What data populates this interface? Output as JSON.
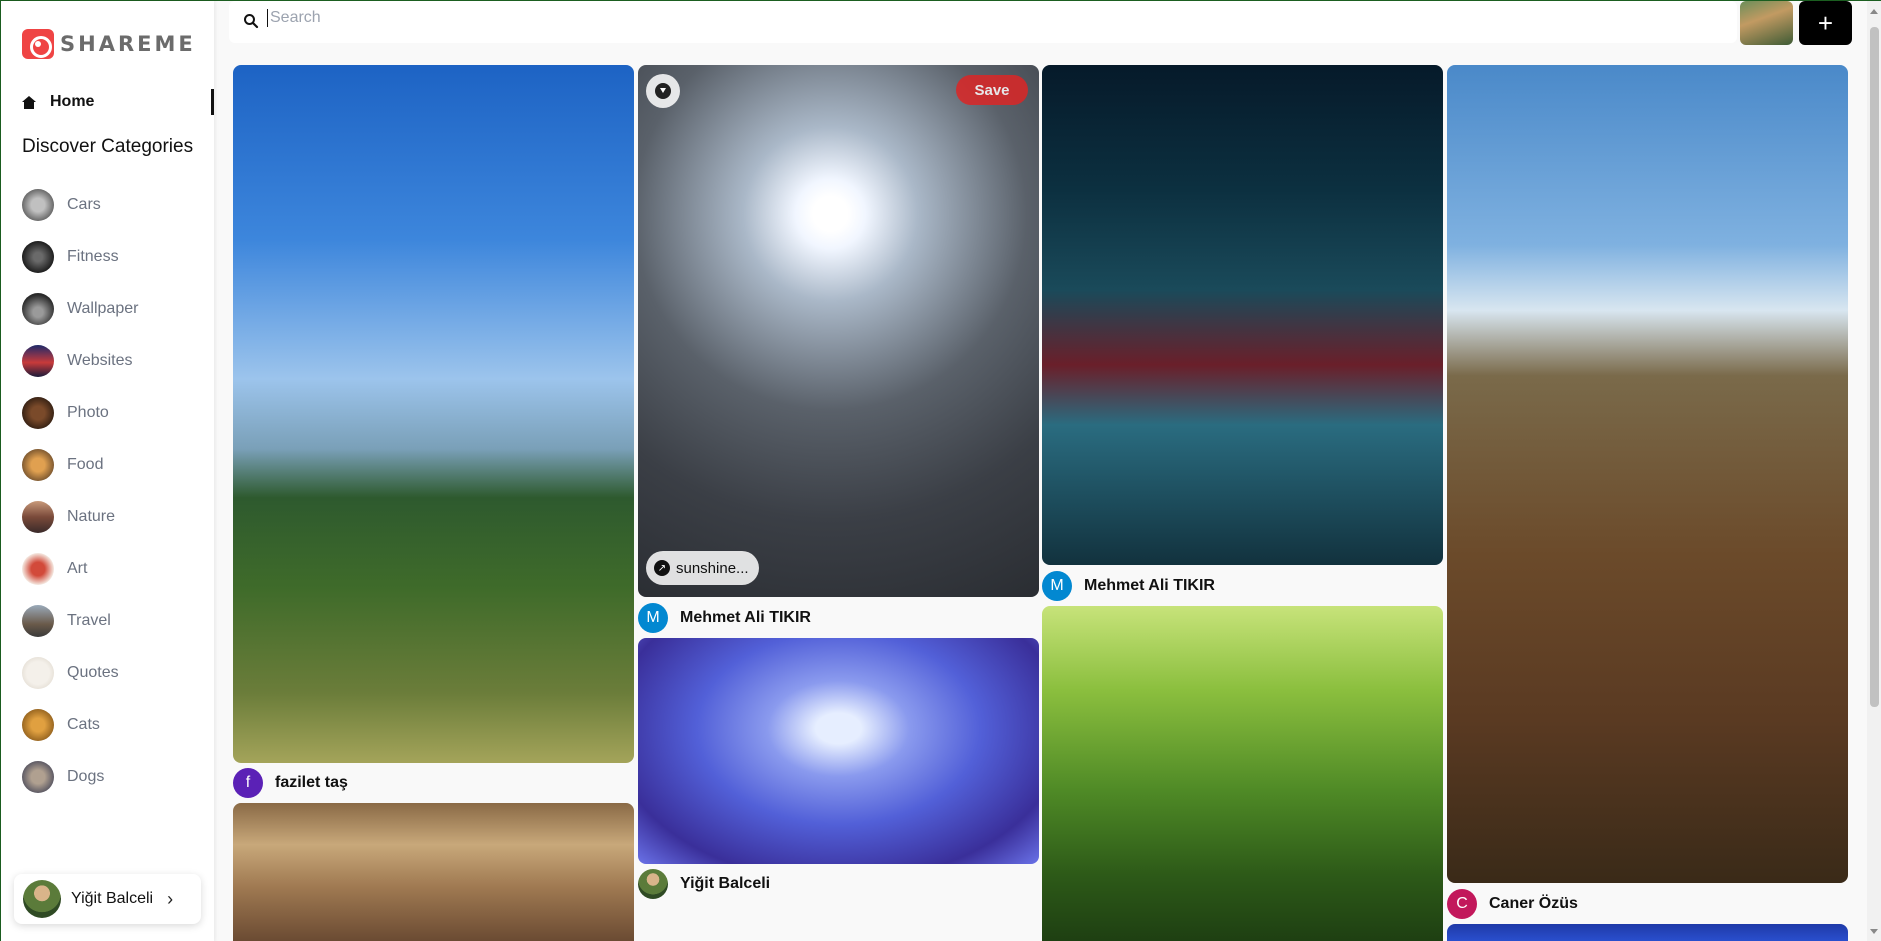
{
  "app": {
    "name": "SHAREME"
  },
  "sidebar": {
    "home_label": "Home",
    "categories_heading": "Discover Categories",
    "categories": [
      {
        "label": "Cars",
        "color": "#8a8a8a"
      },
      {
        "label": "Fitness",
        "color": "#2b2b2b"
      },
      {
        "label": "Wallpaper",
        "color": "#3a3a3a"
      },
      {
        "label": "Websites",
        "color": "#1e2a6a"
      },
      {
        "label": "Photo",
        "color": "#4a2a1a"
      },
      {
        "label": "Food",
        "color": "#b5782f"
      },
      {
        "label": "Nature",
        "color": "#8a5a3a"
      },
      {
        "label": "Art",
        "color": "#d24a3a"
      },
      {
        "label": "Travel",
        "color": "#6a7a8a"
      },
      {
        "label": "Quotes",
        "color": "#e8e2d8"
      },
      {
        "label": "Cats",
        "color": "#c8862a"
      },
      {
        "label": "Dogs",
        "color": "#6a6a7a"
      }
    ],
    "user_name": "Yiğit Balceli"
  },
  "search": {
    "placeholder": "Search",
    "value": ""
  },
  "header": {
    "add_label": "+"
  },
  "pins": [
    {
      "author": "fazilet taş",
      "initial": "f",
      "avatar_color": "#5b21b6"
    },
    {
      "author": "Mehmet Ali TIKIR",
      "initial": "M",
      "avatar_color": "#0288d1",
      "save_label": "Save",
      "link_label": "sunshine..."
    },
    {
      "author": "Yiğit Balceli",
      "initial": "",
      "avatar_color": "#6b8e5a"
    },
    {
      "author": "Mehmet Ali TIKIR",
      "initial": "M",
      "avatar_color": "#0288d1"
    },
    {
      "author": "Caner Özüs",
      "initial": "C",
      "avatar_color": "#c2185b"
    }
  ]
}
